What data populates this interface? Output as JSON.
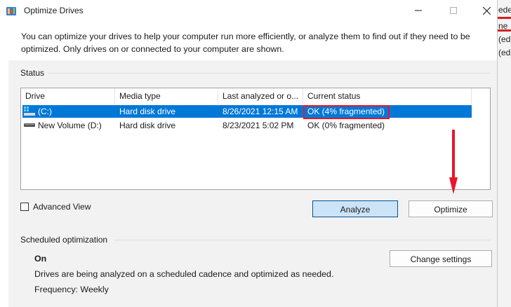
{
  "window": {
    "title": "Optimize Drives",
    "description": "You can optimize your drives to help your computer run more efficiently, or analyze them to find out if they need to be optimized. Only drives on or connected to your computer are shown."
  },
  "status": {
    "label": "Status",
    "columns": [
      "Drive",
      "Media type",
      "Last analyzed or o...",
      "Current status"
    ],
    "drives": [
      {
        "name": "(C:)",
        "media_type": "Hard disk drive",
        "last_analyzed": "8/26/2021 12:15 AM",
        "current_status": "OK (4% fragmented)",
        "selected": true
      },
      {
        "name": "New Volume (D:)",
        "media_type": "Hard disk drive",
        "last_analyzed": "8/23/2021 5:02 PM",
        "current_status": "OK (0% fragmented)",
        "selected": false
      }
    ],
    "advanced_view_label": "Advanced View",
    "analyze_label": "Analyze",
    "optimize_label": "Optimize"
  },
  "schedule": {
    "label": "Scheduled optimization",
    "state": "On",
    "detail": "Drives are being analyzed on a scheduled cadence and optimized as needed.",
    "frequency": "Frequency: Weekly",
    "change_settings_label": "Change settings"
  },
  "background": {
    "fragments": [
      "eded)",
      "ne",
      "(ed)",
      "(ed)"
    ]
  },
  "colors": {
    "selection": "#0078d7",
    "highlight_box": "#e8172a",
    "arrow": "#e8172a",
    "primary_button": "#cce4f7"
  }
}
